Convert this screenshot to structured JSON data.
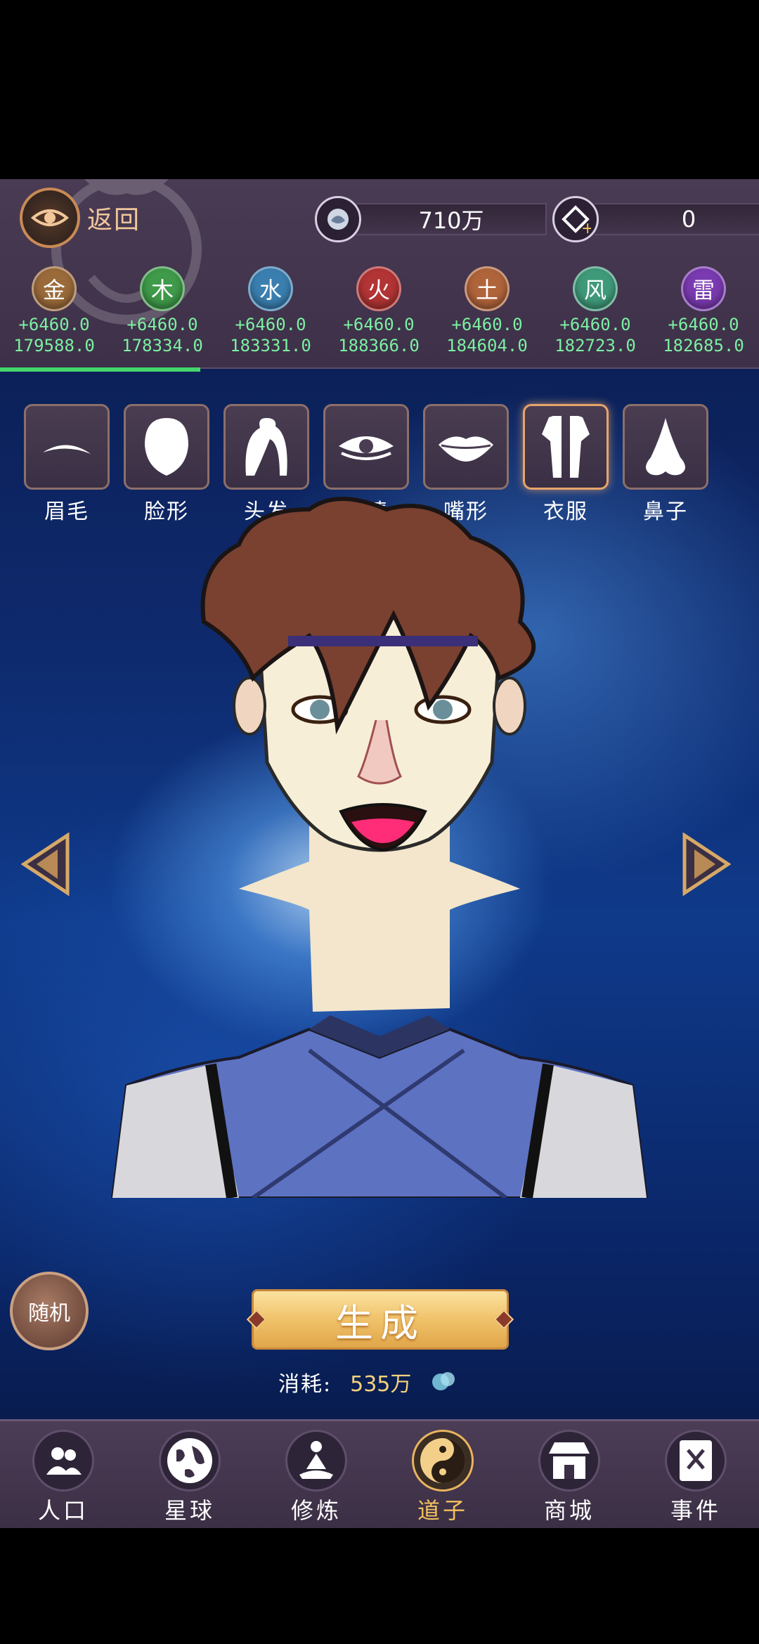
{
  "header": {
    "back_label": "返回",
    "spirit_stones": "710万",
    "currency": "0"
  },
  "elements": [
    {
      "name": "金",
      "rate": "+6460.0",
      "total": "179588.0",
      "color": "#9a6a3a"
    },
    {
      "name": "木",
      "rate": "+6460.0",
      "total": "178334.0",
      "color": "#3f9a4a"
    },
    {
      "name": "水",
      "rate": "+6460.0",
      "total": "183331.0",
      "color": "#3a7fb0"
    },
    {
      "name": "火",
      "rate": "+6460.0",
      "total": "188366.0",
      "color": "#b23434"
    },
    {
      "name": "土",
      "rate": "+6460.0",
      "total": "184604.0",
      "color": "#b0643a"
    },
    {
      "name": "风",
      "rate": "+6460.0",
      "total": "182723.0",
      "color": "#3f9a7a"
    },
    {
      "name": "雷",
      "rate": "+6460.0",
      "total": "182685.0",
      "color": "#7a3ab0"
    }
  ],
  "progress_fraction": 0.264,
  "parts": [
    {
      "label": "眉毛",
      "icon": "eyebrow-icon"
    },
    {
      "label": "脸形",
      "icon": "face-icon"
    },
    {
      "label": "头发",
      "icon": "hair-icon"
    },
    {
      "label": "眼睛",
      "icon": "eye-icon"
    },
    {
      "label": "嘴形",
      "icon": "lips-icon"
    },
    {
      "label": "衣服",
      "icon": "clothes-icon",
      "active": true
    },
    {
      "label": "鼻子",
      "icon": "nose-icon"
    }
  ],
  "actions": {
    "random_label": "随机",
    "generate_label": "生成",
    "cost_label": "消耗:",
    "cost_value": "535万"
  },
  "nav": [
    {
      "label": "人口",
      "icon": "people-icon"
    },
    {
      "label": "星球",
      "icon": "globe-icon"
    },
    {
      "label": "修炼",
      "icon": "meditation-icon"
    },
    {
      "label": "道子",
      "icon": "yin-yang-icon",
      "active": true
    },
    {
      "label": "商城",
      "icon": "shop-icon"
    },
    {
      "label": "事件",
      "icon": "event-book-icon"
    }
  ],
  "colors": {
    "accent_gold": "#f3c15d",
    "element_text": "#7cf0a2",
    "panel": "#4a3b54"
  }
}
